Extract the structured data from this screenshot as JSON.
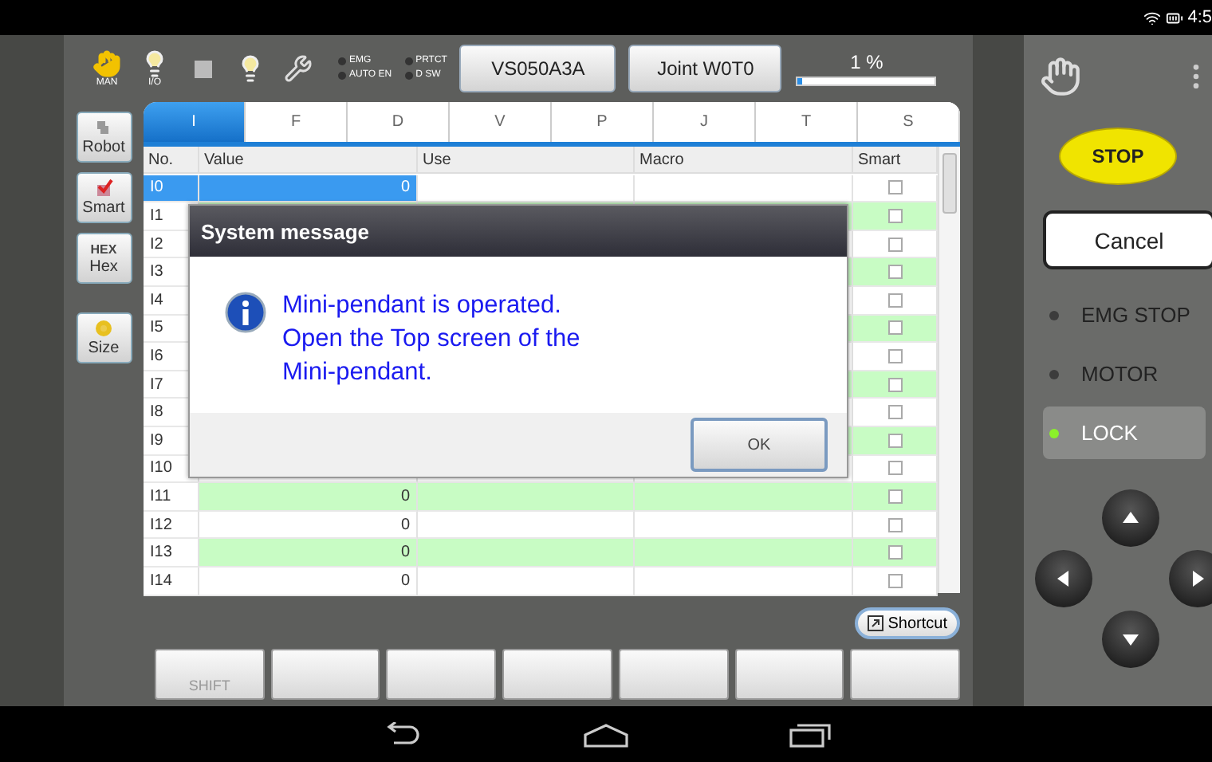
{
  "status_bar": {
    "time": "4:5"
  },
  "toolbar": {
    "icons": [
      {
        "kind": "hand",
        "label": "MAN"
      },
      {
        "kind": "bulb",
        "label": "I/O"
      },
      {
        "kind": "square"
      },
      {
        "kind": "bulb"
      },
      {
        "kind": "wrench"
      }
    ],
    "indicators": [
      {
        "label": "EMG",
        "on": false
      },
      {
        "label": "AUTO EN",
        "on": false
      },
      {
        "label": "PRTCT",
        "on": false
      },
      {
        "label": "D SW",
        "on": false
      }
    ],
    "robot_button": "VS050A3A",
    "mode_button": "Joint W0T0",
    "speed": {
      "reading": "1 %",
      "level": 0.03
    }
  },
  "sidebar": [
    {
      "kind": "robot",
      "label": "Robot"
    },
    {
      "kind": "smart",
      "label": "Smart"
    },
    {
      "kind": "hex",
      "icon_text": "HEX",
      "label": "Hex"
    },
    {
      "kind": "size",
      "label": "Size"
    }
  ],
  "tabs": [
    {
      "label": "I",
      "selected": true
    },
    {
      "label": "F",
      "selected": false
    },
    {
      "label": "D",
      "selected": false
    },
    {
      "label": "V",
      "selected": false
    },
    {
      "label": "P",
      "selected": false
    },
    {
      "label": "J",
      "selected": false
    },
    {
      "label": "T",
      "selected": false
    },
    {
      "label": "S",
      "selected": false
    }
  ],
  "table": {
    "columns": [
      "No.",
      "Value",
      "Use",
      "Macro",
      "Smart"
    ],
    "rows": [
      {
        "no": "I0",
        "value": "0",
        "selected": true,
        "smart": false
      },
      {
        "no": "I1",
        "selected": false,
        "smart": false
      },
      {
        "no": "I2",
        "selected": false,
        "smart": false
      },
      {
        "no": "I3",
        "selected": false,
        "smart": false
      },
      {
        "no": "I4",
        "selected": false,
        "smart": false
      },
      {
        "no": "I5",
        "selected": false,
        "smart": false
      },
      {
        "no": "I6",
        "selected": false,
        "smart": false
      },
      {
        "no": "I7",
        "selected": false,
        "smart": false
      },
      {
        "no": "I8",
        "selected": false,
        "smart": false
      },
      {
        "no": "I9",
        "selected": false,
        "smart": false
      },
      {
        "no": "I10",
        "selected": false,
        "smart": false
      },
      {
        "no": "I11",
        "value": "0",
        "selected": false,
        "smart": false
      },
      {
        "no": "I12",
        "value": "0",
        "selected": false,
        "smart": false
      },
      {
        "no": "I13",
        "value": "0",
        "selected": false,
        "smart": false
      },
      {
        "no": "I14",
        "value": "0",
        "selected": false,
        "smart": false
      }
    ]
  },
  "dialog": {
    "title": "System message",
    "message": "Mini-pendant is operated. Open the Top screen of the Mini-pendant.",
    "button": "OK"
  },
  "shortcut": "Shortcut",
  "function_keys": [
    {
      "kind": "labeled",
      "label": "SHIFT"
    },
    {
      "kind": "blank"
    },
    {
      "kind": "blank"
    },
    {
      "kind": "blank"
    },
    {
      "kind": "blank"
    },
    {
      "kind": "blank"
    },
    {
      "kind": "blank"
    }
  ],
  "right_panel": {
    "stop": "STOP",
    "cancel": "Cancel",
    "lamps": [
      {
        "label": "EMG STOP",
        "on": false
      },
      {
        "label": "MOTOR",
        "on": false
      },
      {
        "label": "LOCK",
        "on": true
      }
    ]
  }
}
